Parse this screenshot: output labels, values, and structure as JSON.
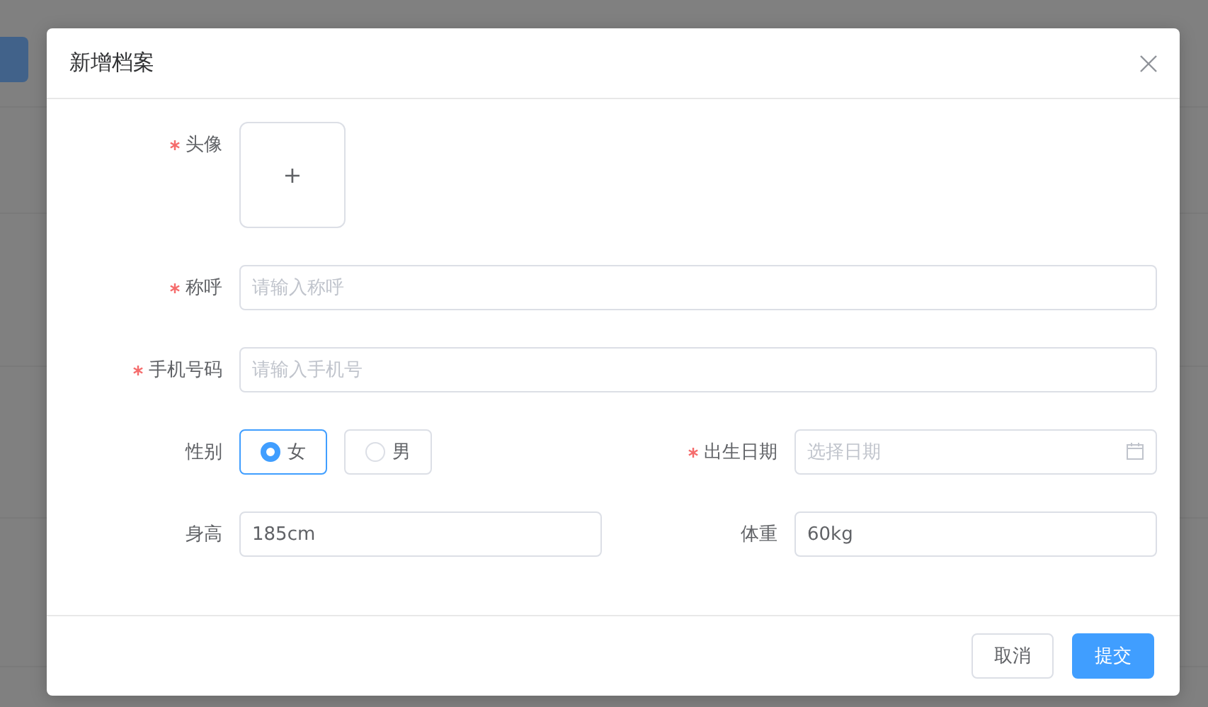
{
  "dialog": {
    "title": "新增档案",
    "rows": [
      {
        "fields": [
          {
            "kind": "upload",
            "label": "头像",
            "required": true,
            "button": "+"
          }
        ]
      },
      {
        "fields": [
          {
            "kind": "text",
            "label": "称呼",
            "required": true,
            "placeholder": "请输入称呼"
          }
        ]
      },
      {
        "fields": [
          {
            "kind": "text",
            "label": "手机号码",
            "required": true,
            "placeholder": "请输入手机号"
          }
        ]
      },
      {
        "fields": [
          {
            "kind": "radio",
            "label": "性别",
            "required": false,
            "options": [
              {
                "label": "女",
                "selected": true
              },
              {
                "label": "男",
                "selected": false
              }
            ]
          },
          {
            "kind": "date",
            "label": "出生日期",
            "required": true,
            "placeholder": "选择日期"
          }
        ]
      },
      {
        "fields": [
          {
            "kind": "text",
            "label": "身高",
            "required": false,
            "value": "185cm"
          },
          {
            "kind": "text",
            "label": "体重",
            "required": false,
            "value": "60kg"
          }
        ]
      }
    ],
    "buttons": [
      {
        "label": "取消",
        "primary": false
      },
      {
        "label": "提交",
        "primary": true
      }
    ]
  }
}
